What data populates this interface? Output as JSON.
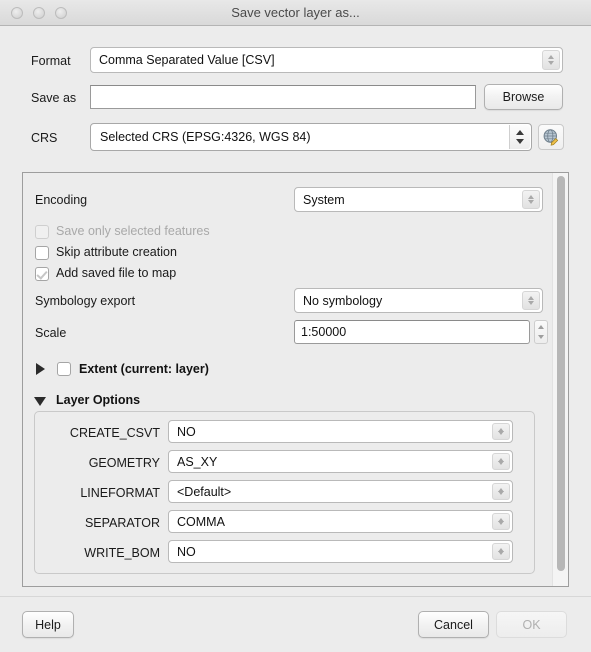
{
  "window": {
    "title": "Save vector layer as...",
    "controls": [
      "close-button",
      "minimize-button",
      "zoom-button"
    ]
  },
  "form": {
    "format": {
      "label": "Format",
      "value": "Comma Separated Value [CSV]"
    },
    "save_as": {
      "label": "Save as",
      "value": "",
      "placeholder": "",
      "browse_label": "Browse"
    },
    "crs": {
      "label": "CRS",
      "value": "Selected CRS (EPSG:4326, WGS 84)",
      "select_icon": "globe-pencil-icon"
    }
  },
  "options": {
    "encoding": {
      "label": "Encoding",
      "value": "System"
    },
    "checkboxes": [
      {
        "label": "Save only selected features",
        "checked": false,
        "enabled": false
      },
      {
        "label": "Skip attribute creation",
        "checked": false,
        "enabled": true
      },
      {
        "label": "Add saved file to map",
        "checked": true,
        "enabled": true
      }
    ],
    "symbology_export": {
      "label": "Symbology export",
      "value": "No symbology"
    },
    "scale": {
      "label": "Scale",
      "value": "1:50000"
    },
    "extent": {
      "label": "Extent (current: layer)",
      "expanded": false,
      "checked": false
    },
    "layer_options": {
      "label": "Layer Options",
      "expanded": true,
      "rows": [
        {
          "key": "CREATE_CSVT",
          "value": "NO"
        },
        {
          "key": "GEOMETRY",
          "value": "AS_XY"
        },
        {
          "key": "LINEFORMAT",
          "value": "<Default>"
        },
        {
          "key": "SEPARATOR",
          "value": "COMMA"
        },
        {
          "key": "WRITE_BOM",
          "value": "NO"
        }
      ]
    }
  },
  "buttons": {
    "help": "Help",
    "cancel": "Cancel",
    "ok": "OK",
    "ok_enabled": false
  },
  "colors": {
    "window_bg": "#ececec",
    "titlebar_top": "#e8e8e8",
    "titlebar_bottom": "#d9d9d9",
    "field_bg": "#ffffff",
    "text": "#1a1a1a",
    "disabled_text": "#a9a9a9",
    "scrollbar_thumb": "#b7b7b7"
  }
}
